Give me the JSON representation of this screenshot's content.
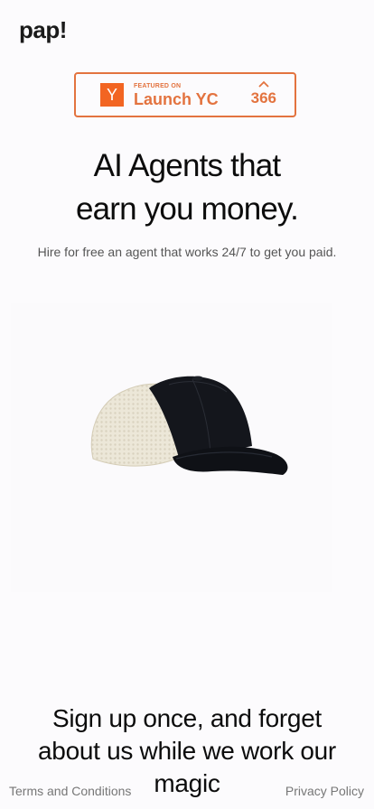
{
  "header": {
    "logo_text": "pap!"
  },
  "yc_badge": {
    "logo_letter": "Y",
    "featured_text": "FEATURED ON",
    "launch_text": "Launch YC",
    "vote_count": "366",
    "accent_color": "#e3733f",
    "logo_color": "#f26522"
  },
  "hero": {
    "headline_line1": "AI Agents that",
    "headline_line2": "earn you money.",
    "subtext": "Hire for free an agent that works 24/7 to get you paid."
  },
  "product": {
    "icon_name": "trucker-cap-image"
  },
  "cta": {
    "line1": "Sign up once, and forget",
    "line2": "about us while we work our",
    "line3": "magic"
  },
  "footer": {
    "terms_label": "Terms and Conditions",
    "privacy_label": "Privacy Policy"
  }
}
